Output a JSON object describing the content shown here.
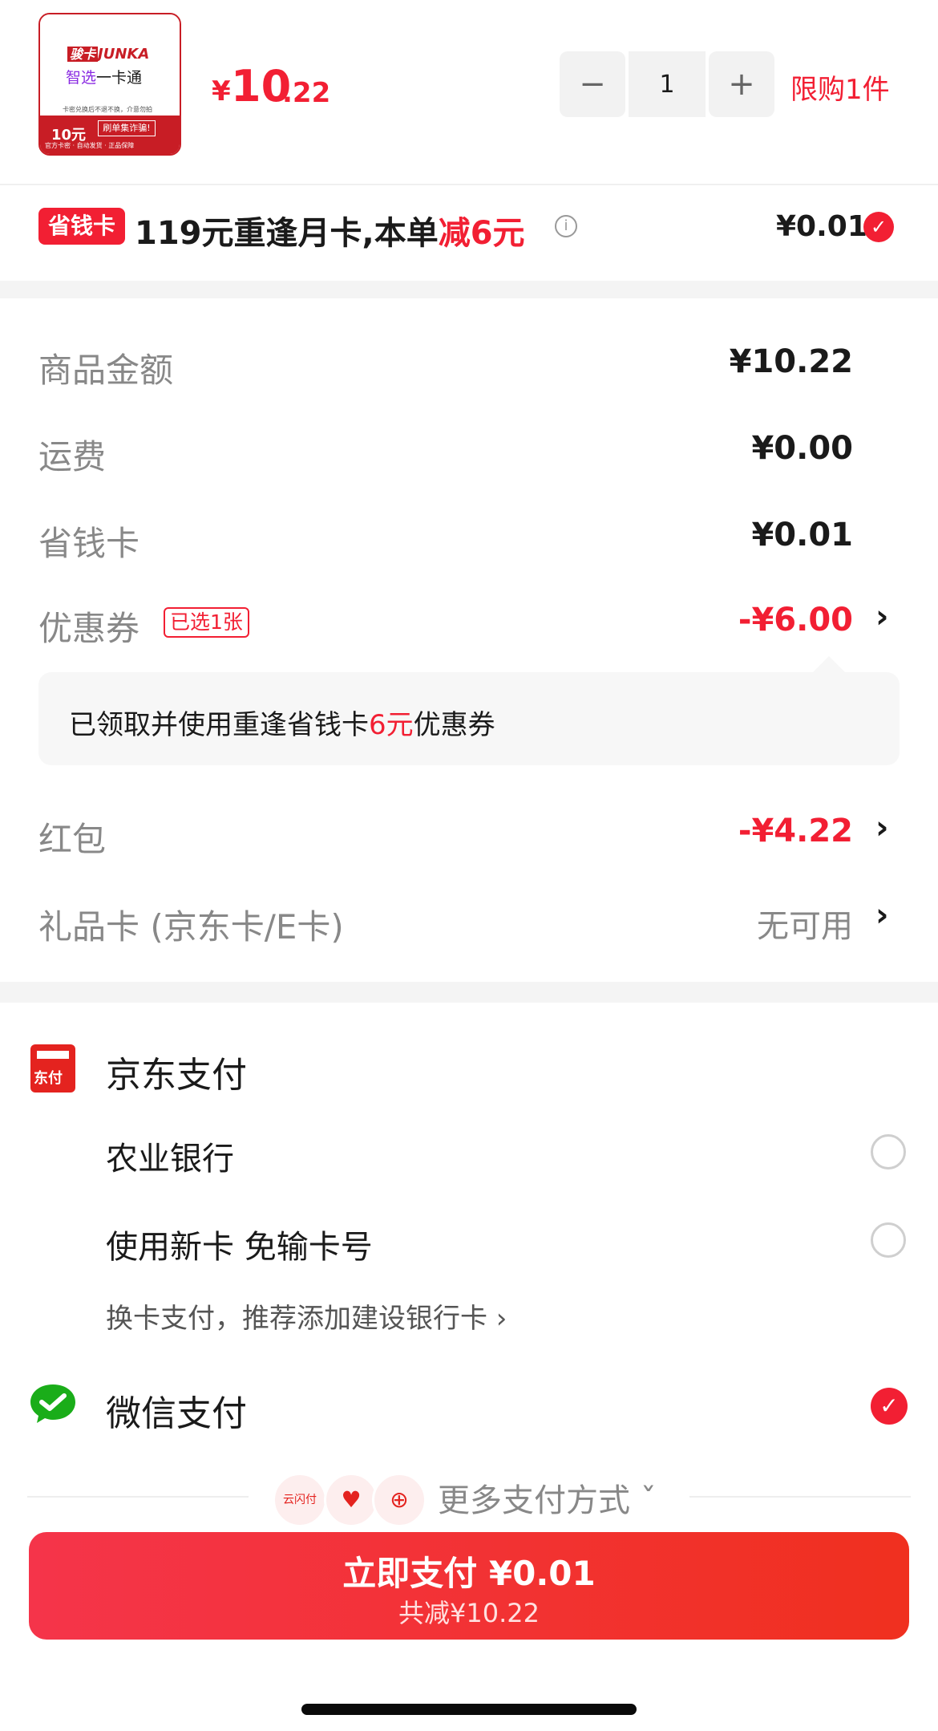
{
  "product": {
    "image_brand_tag": "骏卡",
    "image_brand": "JUNKA",
    "image_line1_a": "智选",
    "image_line1_b": "一卡通",
    "image_note": "卡密兑换后不退不换，介意勿拍",
    "image_value": "10元",
    "image_box": "刷单集诈骗!",
    "image_footer": "官方卡密 · 自动发货 · 正品保障",
    "price_symbol": "¥",
    "price_int": "10",
    "price_dec": ".22",
    "quantity": "1",
    "minus_label": "−",
    "plus_label": "+",
    "limit_label": "限购1件"
  },
  "saving_card": {
    "badge": "省钱卡",
    "text_main": "119元重逢月卡,本单",
    "text_red": "减6元",
    "info_glyph": "i",
    "price": "¥0.01",
    "selected": true
  },
  "summary": {
    "rows": [
      {
        "label": "商品金额",
        "value": "¥10.22"
      },
      {
        "label": "运费",
        "value": "¥0.00"
      },
      {
        "label": "省钱卡",
        "value": "¥0.01"
      }
    ],
    "coupon": {
      "label": "优惠券",
      "tag": "已选1张",
      "value": "-¥6.00"
    },
    "coupon_note": {
      "prefix": "已领取并使用重逢省钱卡",
      "red": "6元",
      "suffix": "优惠券"
    },
    "red_packet": {
      "label": "红包",
      "value": "-¥4.22"
    },
    "gift_card": {
      "label": "礼品卡 (京东卡/E卡)",
      "value": "无可用"
    },
    "chevron": "›"
  },
  "payment": {
    "jd_icon_text": "东付",
    "jd_title": "京东支付",
    "bank": "农业银行",
    "new_card": "使用新卡 免输卡号",
    "switch_link": "换卡支付，推荐添加建设银行卡 ›",
    "wechat_title": "微信支付",
    "more_label": "更多支付方式 ˇ",
    "mini_icons": [
      "云闪付",
      "♥",
      "⊕"
    ]
  },
  "pay_button": {
    "main": "立即支付 ¥0.01",
    "sub": "共减¥10.22"
  },
  "colors": {
    "accent_red": "#f21f33",
    "wechat_green": "#1aad19",
    "jd_red": "#e4231f"
  }
}
